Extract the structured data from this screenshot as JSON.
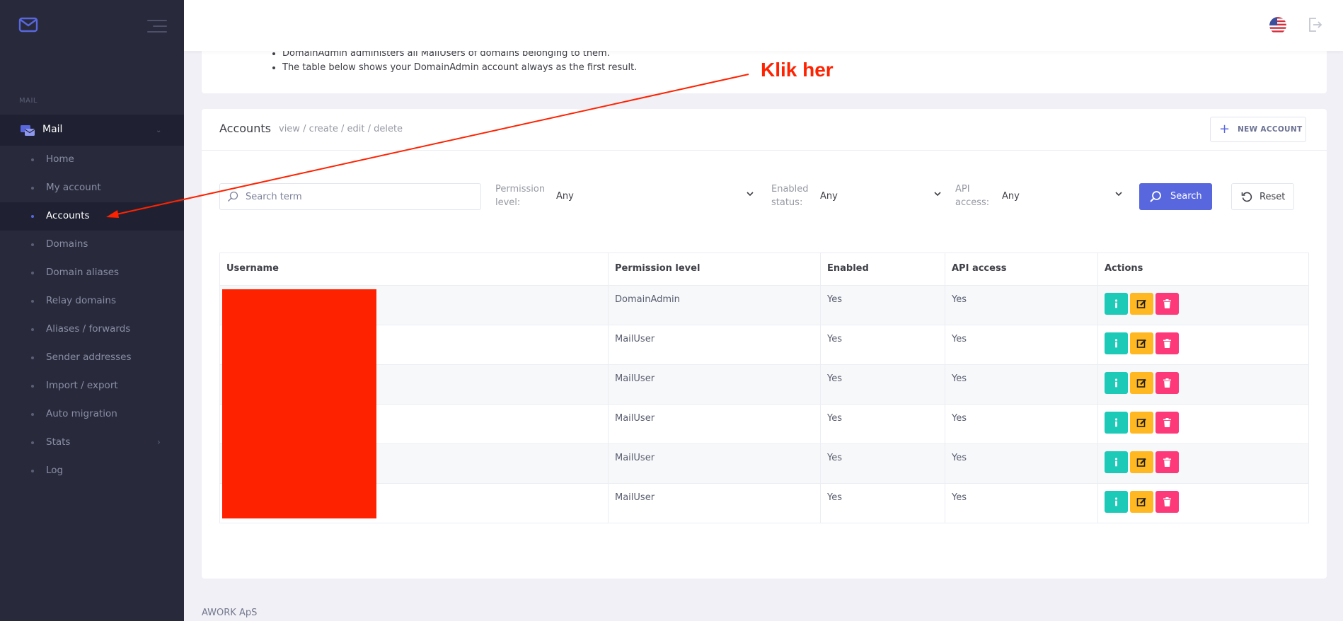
{
  "sidebar": {
    "section_label": "MAIL",
    "group_label": "Mail",
    "items": [
      {
        "label": "Home"
      },
      {
        "label": "My account"
      },
      {
        "label": "Accounts",
        "active": true
      },
      {
        "label": "Domains"
      },
      {
        "label": "Domain aliases"
      },
      {
        "label": "Relay domains"
      },
      {
        "label": "Aliases / forwards"
      },
      {
        "label": "Sender addresses"
      },
      {
        "label": "Import / export"
      },
      {
        "label": "Auto migration"
      },
      {
        "label": "Stats"
      },
      {
        "label": "Log"
      }
    ]
  },
  "topbar": {
    "language_icon": "us-flag-icon",
    "logout_icon": "logout-icon"
  },
  "info": {
    "lines": [
      "DomainAdmin administers all MailUsers of domains belonging to them.",
      "The table below shows your DomainAdmin account always as the first result."
    ]
  },
  "accounts": {
    "title": "Accounts",
    "subtitle": "view / create / edit / delete",
    "new_button": "NEW ACCOUNT",
    "filters": {
      "search_placeholder": "Search term",
      "search_value": "",
      "permission_label_1": "Permission",
      "permission_label_2": "level:",
      "permission_value": "Any",
      "enabled_label_1": "Enabled",
      "enabled_label_2": "status:",
      "enabled_value": "Any",
      "api_label_1": "API",
      "api_label_2": "access:",
      "api_value": "Any",
      "search_button": "Search",
      "reset_button": "Reset"
    },
    "table": {
      "headers": [
        "Username",
        "Permission level",
        "Enabled",
        "API access",
        "Actions"
      ],
      "rows": [
        {
          "username": "",
          "permission": "DomainAdmin",
          "enabled": "Yes",
          "api": "Yes"
        },
        {
          "username": "",
          "permission": "MailUser",
          "enabled": "Yes",
          "api": "Yes"
        },
        {
          "username": "",
          "permission": "MailUser",
          "enabled": "Yes",
          "api": "Yes"
        },
        {
          "username": "",
          "permission": "MailUser",
          "enabled": "Yes",
          "api": "Yes"
        },
        {
          "username": "",
          "permission": "MailUser",
          "enabled": "Yes",
          "api": "Yes"
        },
        {
          "username": "",
          "permission": "MailUser",
          "enabled": "Yes",
          "api": "Yes"
        }
      ]
    }
  },
  "footer": {
    "company": "AWORK ApS"
  },
  "annotation": {
    "text": "Klik her",
    "color": "#ff2200"
  },
  "colors": {
    "sidebar_bg": "#282a3c",
    "accent": "#5867dd",
    "info_btn": "#1dc9b7",
    "edit_btn": "#ffb822",
    "delete_btn": "#fd397a",
    "redaction": "#ff2200"
  }
}
